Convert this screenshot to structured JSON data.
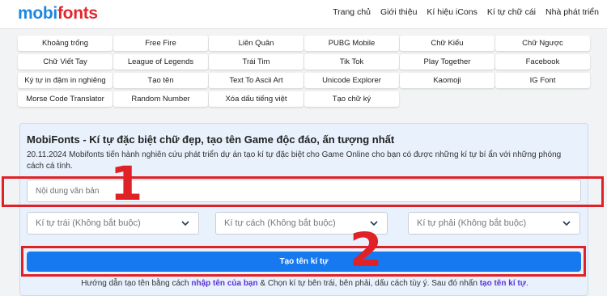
{
  "header": {
    "logo_part1": "mobi",
    "logo_part2": "fonts",
    "nav": [
      "Trang chủ",
      "Giới thiệu",
      "Kí hiệu iCons",
      "Kí tự chữ cái",
      "Nhà phát triển"
    ]
  },
  "chips": [
    "Khoảng trống",
    "Free Fire",
    "Liên Quân",
    "PUBG Mobile",
    "Chữ Kiểu",
    "Chữ Ngược",
    "Chữ Viết Tay",
    "League of Legends",
    "Trái Tim",
    "Tik Tok",
    "Play Together",
    "Facebook",
    "Ký tự in đậm in nghiêng",
    "Tạo tên",
    "Text To Ascii Art",
    "Unicode Explorer",
    "Kaomoji",
    "IG Font",
    "Morse Code Translator",
    "Random Number",
    "Xóa dấu tiếng việt",
    "Tạo chữ ký"
  ],
  "panel": {
    "title": "MobiFonts - Kí tự đặc biệt chữ đẹp, tạo tên Game độc đáo, ấn tượng nhất",
    "description": "20.11.2024 Mobifonts tiến hành nghiên cứu phát triển dự án tạo kí tự đặc biệt cho Game Online cho bạn có được những kí tự bí ẩn với những phóng cách cá tính.",
    "input_placeholder": "Nội dung văn bản",
    "selects": [
      "Kí tự trái (Không bắt buộc)",
      "Kí tự cách (Không bắt buộc)",
      "Kí tự phải (Không bắt buộc)"
    ],
    "submit_label": "Tạo tên kí tự",
    "hint_prefix": "Hướng dẫn tạo tên bằng cách ",
    "hint_highlight1": "nhập tên của bạn",
    "hint_middle": " & Chọn kí tự bên trái, bên phải, dấu cách tùy ý. Sau đó nhấn ",
    "hint_highlight2": "tạo tên kí tự",
    "hint_suffix": "."
  },
  "annotations": {
    "step1": "1",
    "step2": "2",
    "color": "#e02126"
  },
  "colors": {
    "accent": "#1679ef",
    "logo_blue": "#1d86e0",
    "logo_red": "#e3262f",
    "highlight_text": "#5a35d6"
  }
}
